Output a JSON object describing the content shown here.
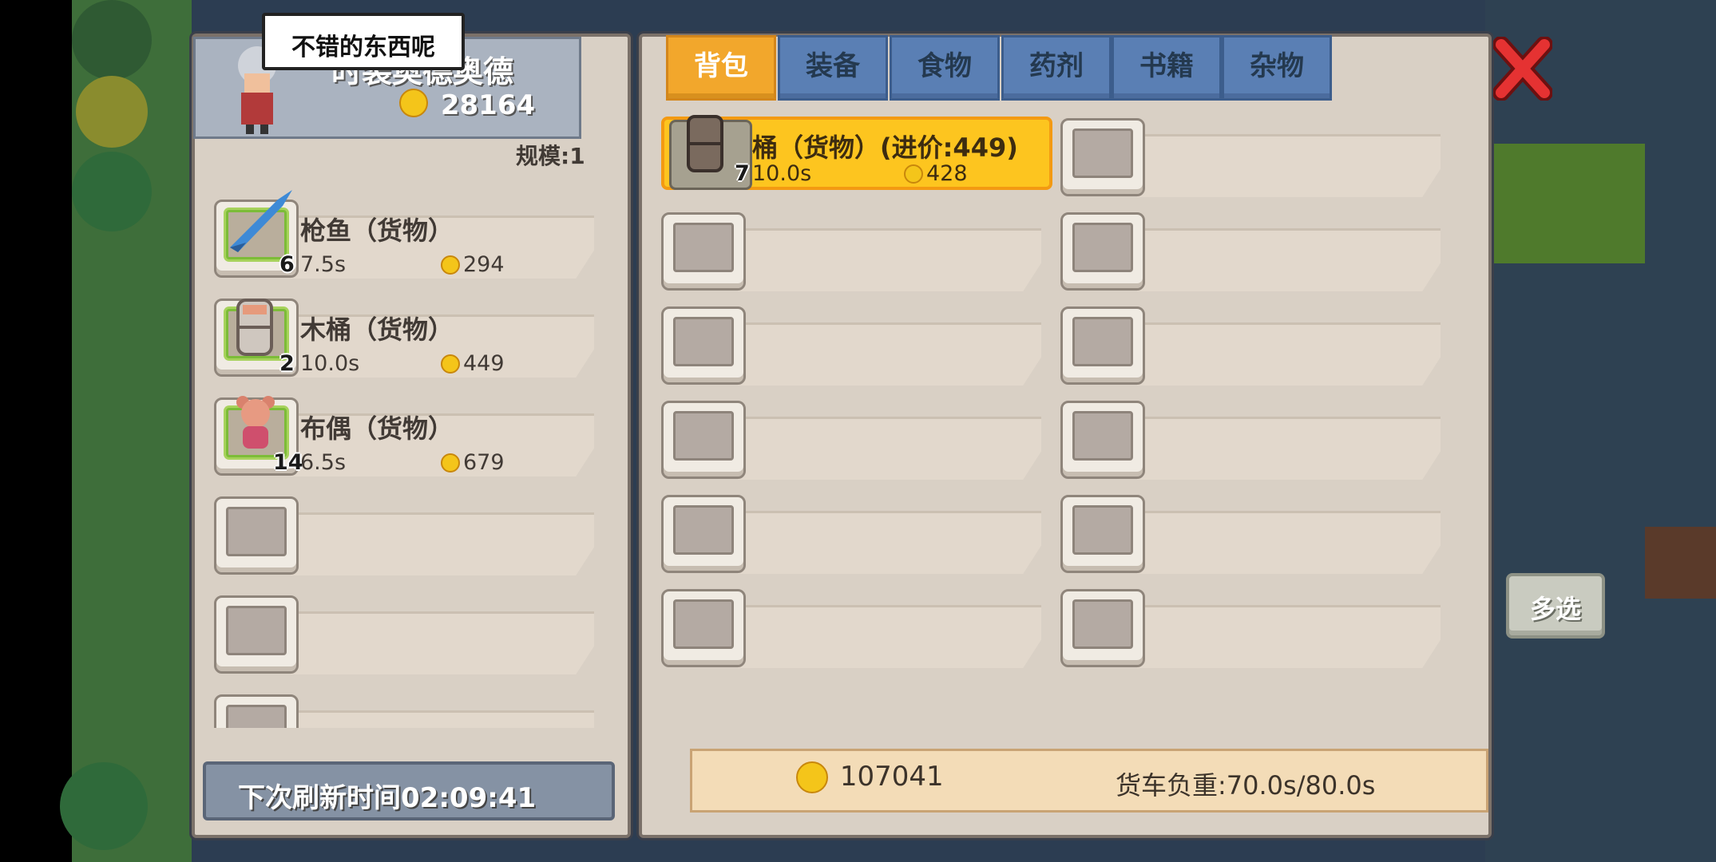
{
  "colors": {
    "accent": "#f2a72c",
    "tab": "#5a7fb4",
    "highlight": "#fdc51f",
    "merch_border": "#a7d25c"
  },
  "merchant": {
    "speech": "不错的东西呢",
    "name": "时装奥德奥德",
    "gold": "28164",
    "scale": "规模:1",
    "items": [
      {
        "name": "枪鱼（货物）",
        "weight": "7.5s",
        "price": "294",
        "count": "6",
        "icon": "swordfish-icon"
      },
      {
        "name": "木桶（货物）",
        "weight": "10.0s",
        "price": "449",
        "count": "2",
        "icon": "barrel-icon"
      },
      {
        "name": "布偶（货物）",
        "weight": "6.5s",
        "price": "679",
        "count": "14",
        "icon": "teddy-bear-icon"
      }
    ],
    "refresh": "下次刷新时间02:09:41"
  },
  "tabs": [
    "背包",
    "装备",
    "食物",
    "药剂",
    "书籍",
    "杂物"
  ],
  "active_tab": 0,
  "bag": {
    "selected": {
      "name": "桶（货物）(进价:449)",
      "weight": "10.0s",
      "price": "428",
      "count": "7",
      "icon": "barrel-icon"
    }
  },
  "footer": {
    "gold": "107041",
    "load": "货车负重:70.0s/80.0s"
  },
  "multiselect": "多选",
  "close_icon": "close-x-icon"
}
